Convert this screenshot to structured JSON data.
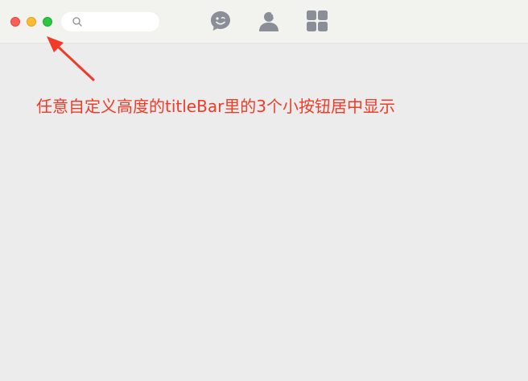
{
  "window": {
    "traffic_lights": [
      "close",
      "minimize",
      "maximize"
    ]
  },
  "search": {
    "value": "",
    "placeholder": "",
    "icon": "search-icon"
  },
  "nav": {
    "items": [
      {
        "icon": "chat-icon"
      },
      {
        "icon": "contacts-icon"
      },
      {
        "icon": "apps-grid-icon"
      }
    ]
  },
  "annotation": {
    "text": "任意自定义高度的titleBar里的3个小按钮居中显示",
    "color": "#f03b28"
  },
  "colors": {
    "titlebar_bg": "#f2f2ef",
    "content_bg": "#ececec",
    "icon_gray": "#8a8f97",
    "close": "#fd5f57",
    "minimize": "#febc2e",
    "maximize": "#28c840"
  }
}
